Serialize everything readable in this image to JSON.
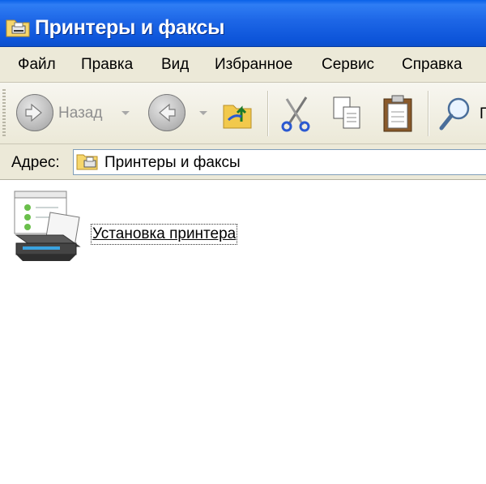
{
  "window": {
    "title": "Принтеры и факсы",
    "title_icon": "printer-folder-icon"
  },
  "menu": {
    "items": [
      {
        "label": "Файл"
      },
      {
        "label": "Правка"
      },
      {
        "label": "Вид"
      },
      {
        "label": "Избранное"
      },
      {
        "label": "Сервис"
      },
      {
        "label": "Справка"
      }
    ]
  },
  "toolbar": {
    "back_label": "Назад",
    "back_enabled": false,
    "forward_enabled": false,
    "partial_label": "П",
    "icons": [
      "back-arrow-icon",
      "forward-arrow-icon",
      "folder-up-icon",
      "scissors-icon",
      "copy-icon",
      "clipboard-icon",
      "search-icon"
    ]
  },
  "address": {
    "label": "Адрес:",
    "value": "Принтеры и факсы",
    "icon": "printers-folder-icon"
  },
  "content": {
    "tasks": [
      {
        "label": "Установка принтера",
        "icon": "add-printer-icon"
      }
    ]
  },
  "colors": {
    "titlebar": "#1d66e6",
    "chrome": "#ece9d8",
    "address_border": "#7f9db9"
  }
}
